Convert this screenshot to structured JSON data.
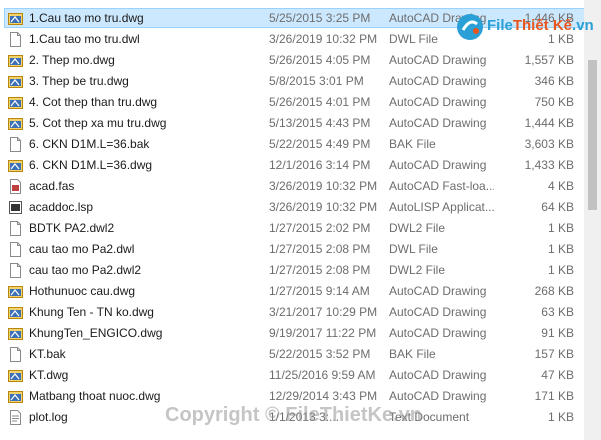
{
  "files": [
    {
      "name": "1.Cau tao mo tru.dwg",
      "date": "5/25/2015 3:25 PM",
      "type": "AutoCAD Drawing",
      "size": "1,446 KB",
      "icon": "dwg-icon",
      "selected": true
    },
    {
      "name": "1.Cau tao mo tru.dwl",
      "date": "3/26/2019 10:32 PM",
      "type": "DWL File",
      "size": "1 KB",
      "icon": "blank-file-icon"
    },
    {
      "name": "2. Thep mo.dwg",
      "date": "5/26/2015 4:05 PM",
      "type": "AutoCAD Drawing",
      "size": "1,557 KB",
      "icon": "dwg-icon"
    },
    {
      "name": "3. Thep be tru.dwg",
      "date": "5/8/2015 3:01 PM",
      "type": "AutoCAD Drawing",
      "size": "346 KB",
      "icon": "dwg-icon"
    },
    {
      "name": "4. Cot thep than tru.dwg",
      "date": "5/26/2015 4:01 PM",
      "type": "AutoCAD Drawing",
      "size": "750 KB",
      "icon": "dwg-icon"
    },
    {
      "name": "5. Cot thep xa mu tru.dwg",
      "date": "5/13/2015 4:43 PM",
      "type": "AutoCAD Drawing",
      "size": "1,444 KB",
      "icon": "dwg-icon"
    },
    {
      "name": "6. CKN D1M.L=36.bak",
      "date": "5/22/2015 4:49 PM",
      "type": "BAK File",
      "size": "3,603 KB",
      "icon": "blank-file-icon"
    },
    {
      "name": "6. CKN D1M.L=36.dwg",
      "date": "12/1/2016 3:14 PM",
      "type": "AutoCAD Drawing",
      "size": "1,433 KB",
      "icon": "dwg-icon"
    },
    {
      "name": "acad.fas",
      "date": "3/26/2019 10:32 PM",
      "type": "AutoCAD Fast-loa...",
      "size": "4 KB",
      "icon": "fas-file-icon"
    },
    {
      "name": "acaddoc.lsp",
      "date": "3/26/2019 10:32 PM",
      "type": "AutoLISP Applicat...",
      "size": "64 KB",
      "icon": "lsp-file-icon"
    },
    {
      "name": "BDTK PA2.dwl2",
      "date": "1/27/2015 2:02 PM",
      "type": "DWL2 File",
      "size": "1 KB",
      "icon": "blank-file-icon"
    },
    {
      "name": "cau tao mo Pa2.dwl",
      "date": "1/27/2015 2:08 PM",
      "type": "DWL File",
      "size": "1 KB",
      "icon": "blank-file-icon"
    },
    {
      "name": "cau tao mo Pa2.dwl2",
      "date": "1/27/2015 2:08 PM",
      "type": "DWL2 File",
      "size": "1 KB",
      "icon": "blank-file-icon"
    },
    {
      "name": "Hothunuoc cau.dwg",
      "date": "1/27/2015 9:14 AM",
      "type": "AutoCAD Drawing",
      "size": "268 KB",
      "icon": "dwg-icon"
    },
    {
      "name": "Khung Ten - TN ko.dwg",
      "date": "3/21/2017 10:29 PM",
      "type": "AutoCAD Drawing",
      "size": "63 KB",
      "icon": "dwg-icon"
    },
    {
      "name": "KhungTen_ENGICO.dwg",
      "date": "9/19/2017 11:22 PM",
      "type": "AutoCAD Drawing",
      "size": "91 KB",
      "icon": "dwg-icon"
    },
    {
      "name": "KT.bak",
      "date": "5/22/2015 3:52 PM",
      "type": "BAK File",
      "size": "157 KB",
      "icon": "blank-file-icon"
    },
    {
      "name": "KT.dwg",
      "date": "11/25/2016 9:59 AM",
      "type": "AutoCAD Drawing",
      "size": "47 KB",
      "icon": "dwg-icon"
    },
    {
      "name": "Matbang thoat nuoc.dwg",
      "date": "12/29/2014 3:43 PM",
      "type": "AutoCAD Drawing",
      "size": "171 KB",
      "icon": "dwg-icon"
    },
    {
      "name": "plot.log",
      "date": "1/1/2013 3:...",
      "type": "Text Document",
      "size": "1 KB",
      "icon": "text-file-icon"
    }
  ],
  "logo": {
    "prefix": "File",
    "main": "Thiết Kế",
    "suffix": ".vn"
  },
  "watermark": "Copyright © FileThietKe.vn",
  "colors": {
    "selection": "#cce8ff",
    "selection_border": "#99d1ff",
    "secondary_text": "#6d6d6d",
    "logo_blue": "#2aa0d6",
    "logo_orange": "#e8561e"
  }
}
